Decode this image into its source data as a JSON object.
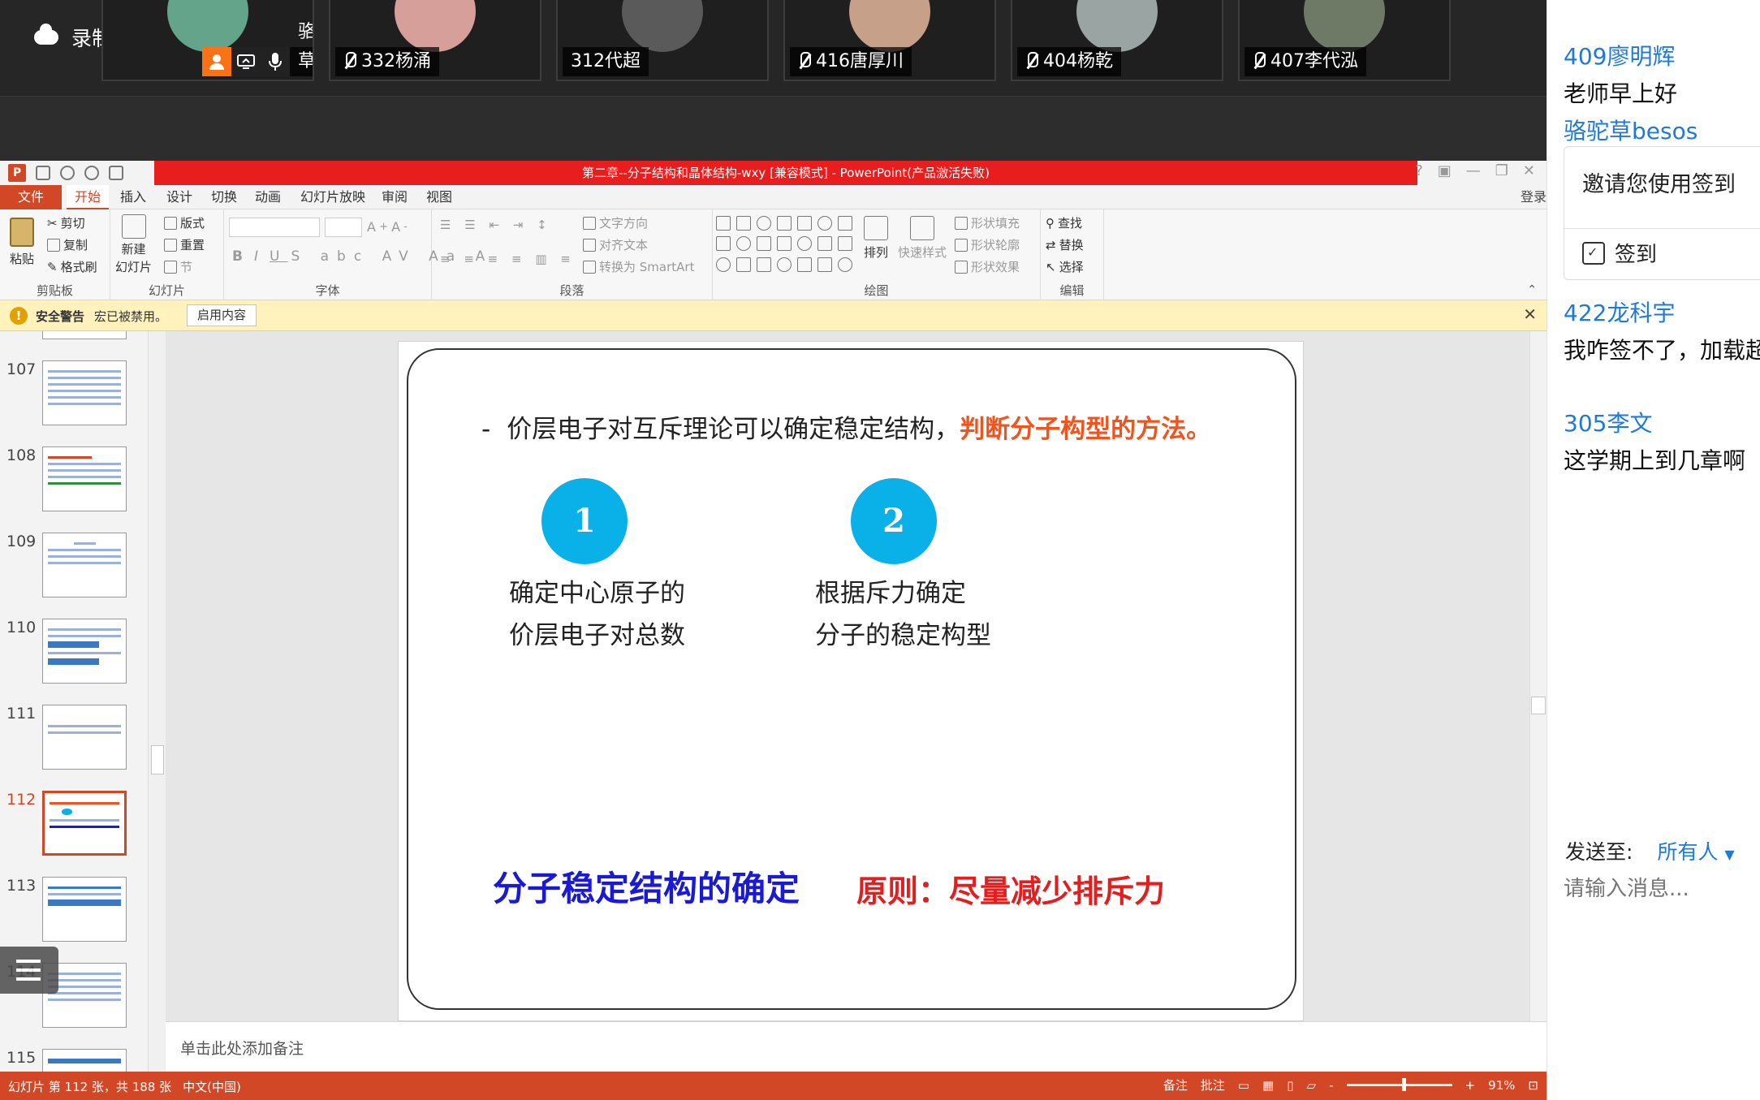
{
  "video_strip": {
    "recording_label": "录制中",
    "tiles": [
      {
        "name": "骆驼草be...",
        "muted": false,
        "avatar_color": "#63a48a"
      },
      {
        "name": "332杨涌",
        "muted": true,
        "avatar_color": "#d79f9a"
      },
      {
        "name": "312代超",
        "muted": false,
        "avatar_color": "#5a5a5a"
      },
      {
        "name": "416唐厚川",
        "muted": true,
        "avatar_color": "#c7a08a"
      },
      {
        "name": "404杨乾",
        "muted": true,
        "avatar_color": "#9aa4a2"
      },
      {
        "name": "407李代泓",
        "muted": true,
        "avatar_color": "#6f7a66"
      }
    ]
  },
  "ppt": {
    "title": "第二章--分子结构和晶体结构-wxy [兼容模式] -  PowerPoint(产品激活失败)",
    "menu": {
      "file": "文件",
      "tabs": [
        "开始",
        "插入",
        "设计",
        "切换",
        "动画",
        "幻灯片放映",
        "审阅",
        "视图"
      ],
      "login": "登录"
    },
    "ribbon": {
      "clipboard": {
        "paste": "粘贴",
        "cut": "剪切",
        "copy": "复制",
        "format_painter": "格式刷",
        "label": "剪贴板"
      },
      "slides": {
        "new_slide_1": "新建",
        "new_slide_2": "幻灯片",
        "layout": "版式",
        "reset": "重置",
        "section": "节",
        "label": "幻灯片"
      },
      "font": {
        "label": "字体"
      },
      "paragraph": {
        "text_direction": "文字方向",
        "align_text": "对齐文本",
        "smartart": "转换为 SmartArt",
        "label": "段落"
      },
      "drawing": {
        "arrange": "排列",
        "quick_styles": "快速样式",
        "shape_fill": "形状填充",
        "shape_outline": "形状轮廓",
        "shape_effects": "形状效果",
        "label": "绘图"
      },
      "editing": {
        "find": "查找",
        "replace": "替换",
        "select": "选择",
        "label": "编辑"
      }
    },
    "security": {
      "title": "安全警告",
      "message": "宏已被禁用。",
      "button": "启用内容"
    },
    "thumbnails": [
      {
        "num": "107",
        "selected": false
      },
      {
        "num": "108",
        "selected": false
      },
      {
        "num": "109",
        "selected": false
      },
      {
        "num": "110",
        "selected": false
      },
      {
        "num": "111",
        "selected": false
      },
      {
        "num": "112",
        "selected": true
      },
      {
        "num": "113",
        "selected": false
      },
      {
        "num": "114",
        "selected": false
      },
      {
        "num": "115",
        "selected": false
      }
    ],
    "slide": {
      "dash": "-",
      "heading": "价层电子对互斥理论可以确定稳定结构，",
      "heading_em": "判断分子构型的方法。",
      "step1_num": "1",
      "step1_line1": "确定中心原子的",
      "step1_line2": "价层电子对总数",
      "step2_num": "2",
      "step2_line1": "根据斥力确定",
      "step2_line2": "分子的稳定构型",
      "bottom_left": "分子稳定结构的确定",
      "bottom_right": "原则：尽量减少排斥力",
      "colors": {
        "accent_circle": "#0ab0e8",
        "heading_em": "#f0541e",
        "bottom_left": "#1a1ad6",
        "bottom_right": "#e41e1e"
      }
    },
    "notes_placeholder": "单击此处添加备注",
    "status": {
      "slide_info": "幻灯片 第 112 张，共 188 张",
      "language": "中文(中国)",
      "notes": "备注",
      "comments": "批注",
      "zoom_minus": "-",
      "zoom_plus": "+",
      "zoom": "91%"
    }
  },
  "chat": {
    "messages": [
      {
        "sender": "409廖明辉",
        "text": "老师早上好"
      },
      {
        "sender": "骆驼草besos",
        "text": ""
      },
      {
        "sender": "422龙科宇",
        "text": "我咋签不了，加载超"
      },
      {
        "sender": "305李文",
        "text": "这学期上到几章啊"
      }
    ],
    "invite_text": "邀请您使用签到",
    "signin_label": "签到",
    "send_to_label": "发送至:",
    "send_to_value": "所有人",
    "input_placeholder": "请输入消息..."
  }
}
